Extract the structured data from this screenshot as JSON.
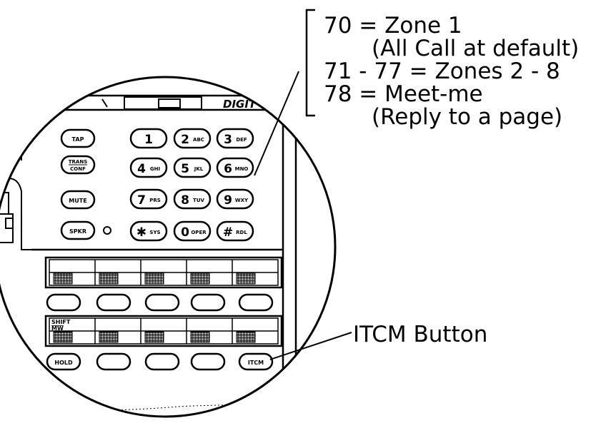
{
  "callout": {
    "lines": [
      "70 = Zone 1",
      "(All Call at default)",
      "71 - 77 = Zones 2 - 8",
      "78 = Meet-me",
      "(Reply to a page)"
    ]
  },
  "itcm_callout": "ITCM Button",
  "figure_id": "AW234",
  "display_label": "DIGIT",
  "feature_keys": {
    "tap": "TAP",
    "trans_top": "TRANS",
    "trans_bottom": "CONF",
    "mute": "MUTE",
    "spkr": "SPKR",
    "hold": "HOLD",
    "itcm": "ITCM"
  },
  "shift_label_top": "SHIFT",
  "shift_label_bottom": "MW",
  "dialpad": [
    {
      "digit": "1",
      "letters": ""
    },
    {
      "digit": "2",
      "letters": "ABC"
    },
    {
      "digit": "3",
      "letters": "DEF"
    },
    {
      "digit": "4",
      "letters": "GHI"
    },
    {
      "digit": "5",
      "letters": "JKL"
    },
    {
      "digit": "6",
      "letters": "MNO"
    },
    {
      "digit": "7",
      "letters": "PRS"
    },
    {
      "digit": "8",
      "letters": "TUV"
    },
    {
      "digit": "9",
      "letters": "WXY"
    },
    {
      "digit": "✱",
      "letters": "SYS"
    },
    {
      "digit": "0",
      "letters": "OPER"
    },
    {
      "digit": "#",
      "letters": "RDL"
    }
  ],
  "colors": {
    "ink": "#000000",
    "paper": "#ffffff",
    "hatch": "#000000"
  }
}
